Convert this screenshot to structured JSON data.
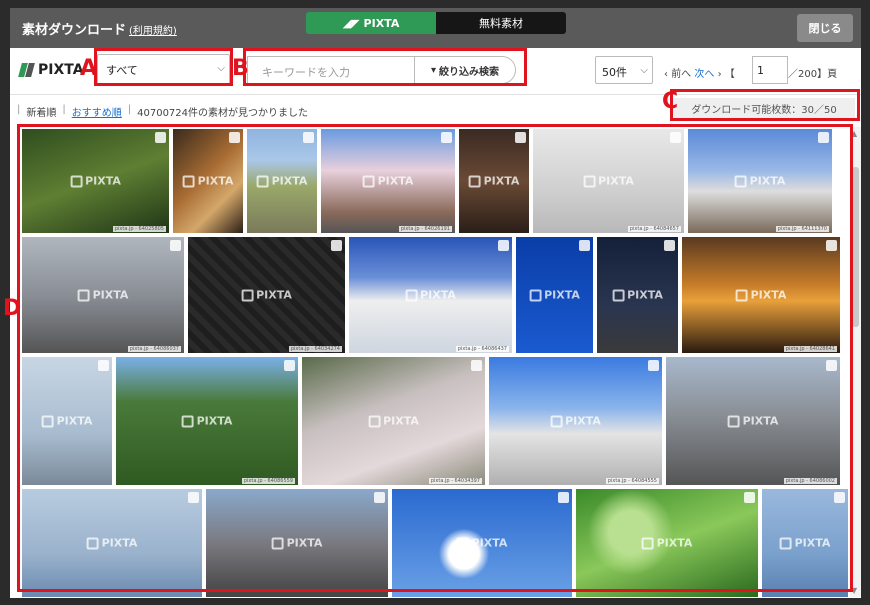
{
  "header": {
    "title": "素材ダウンロード",
    "terms_link": "(利用規約)",
    "tab_pixta": "PIXTA",
    "tab_free": "無料素材",
    "close_label": "閉じる",
    "brand_color": "#2e9a56"
  },
  "toolbar": {
    "logo_text": "PIXTA",
    "category_value": "すべて",
    "search_placeholder": "キーワードを入力",
    "filter_label": "絞り込み検索",
    "per_page_value": "50件",
    "prev_label": "前へ",
    "next_label": "次へ",
    "page_value": "1",
    "page_total": "／200】頁"
  },
  "subbar": {
    "sort_new": "新着順",
    "sort_recommended": "おすすめ順",
    "result_count": "40700724件の素材が見つかりました",
    "download_remaining": "ダウンロード可能枚数：30／50"
  },
  "annotations": {
    "a": "A",
    "b": "B",
    "c": "C",
    "d": "D",
    "color": "#e0141e"
  },
  "watermark": "PIXTA",
  "images": [
    {
      "caption": "pixta.jp - 64025805"
    },
    {
      "caption": ""
    },
    {
      "caption": ""
    },
    {
      "caption": "pixta.jp - 64026191"
    },
    {
      "caption": ""
    },
    {
      "caption": "pixta.jp - 64084657"
    },
    {
      "caption": "pixta.jp - 64111370"
    },
    {
      "caption": "pixta.jp - 64086037"
    },
    {
      "caption": "pixta.jp - 64034274"
    },
    {
      "caption": "pixta.jp - 64086437"
    },
    {
      "caption": ""
    },
    {
      "caption": ""
    },
    {
      "caption": "pixta.jp - 64028641"
    },
    {
      "caption": ""
    },
    {
      "caption": "pixta.jp - 64086559"
    },
    {
      "caption": "pixta.jp - 64034397"
    },
    {
      "caption": "pixta.jp - 64084555"
    },
    {
      "caption": "pixta.jp - 64086002"
    },
    {
      "caption": ""
    },
    {
      "caption": ""
    },
    {
      "caption": ""
    },
    {
      "caption": ""
    },
    {
      "caption": ""
    }
  ]
}
